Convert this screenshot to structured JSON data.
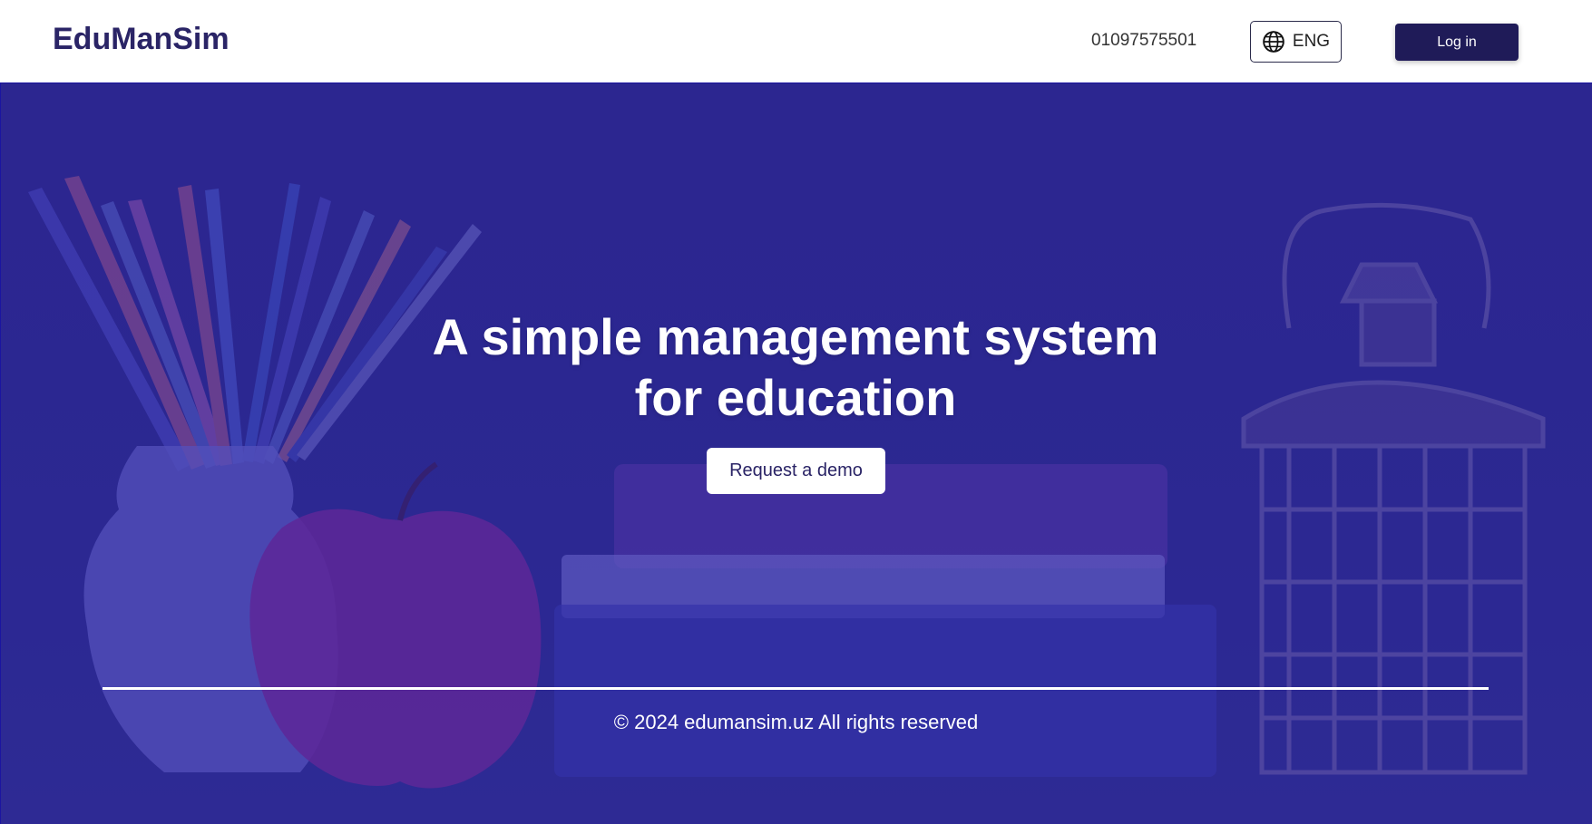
{
  "header": {
    "logo": "EduManSim",
    "phone": "01097575501",
    "language_label": "ENG",
    "login_label": "Log in"
  },
  "hero": {
    "title_line1": "A simple management system",
    "title_line2": "for education",
    "demo_label": "Request a demo"
  },
  "footer": {
    "copyright": "© 2024 edumansim.uz  All rights reserved"
  },
  "colors": {
    "brand": "#2a2466",
    "login_bg": "#1f1b58",
    "hero_overlay": "#2e2a90"
  },
  "icons": {
    "language": "globe-icon"
  }
}
